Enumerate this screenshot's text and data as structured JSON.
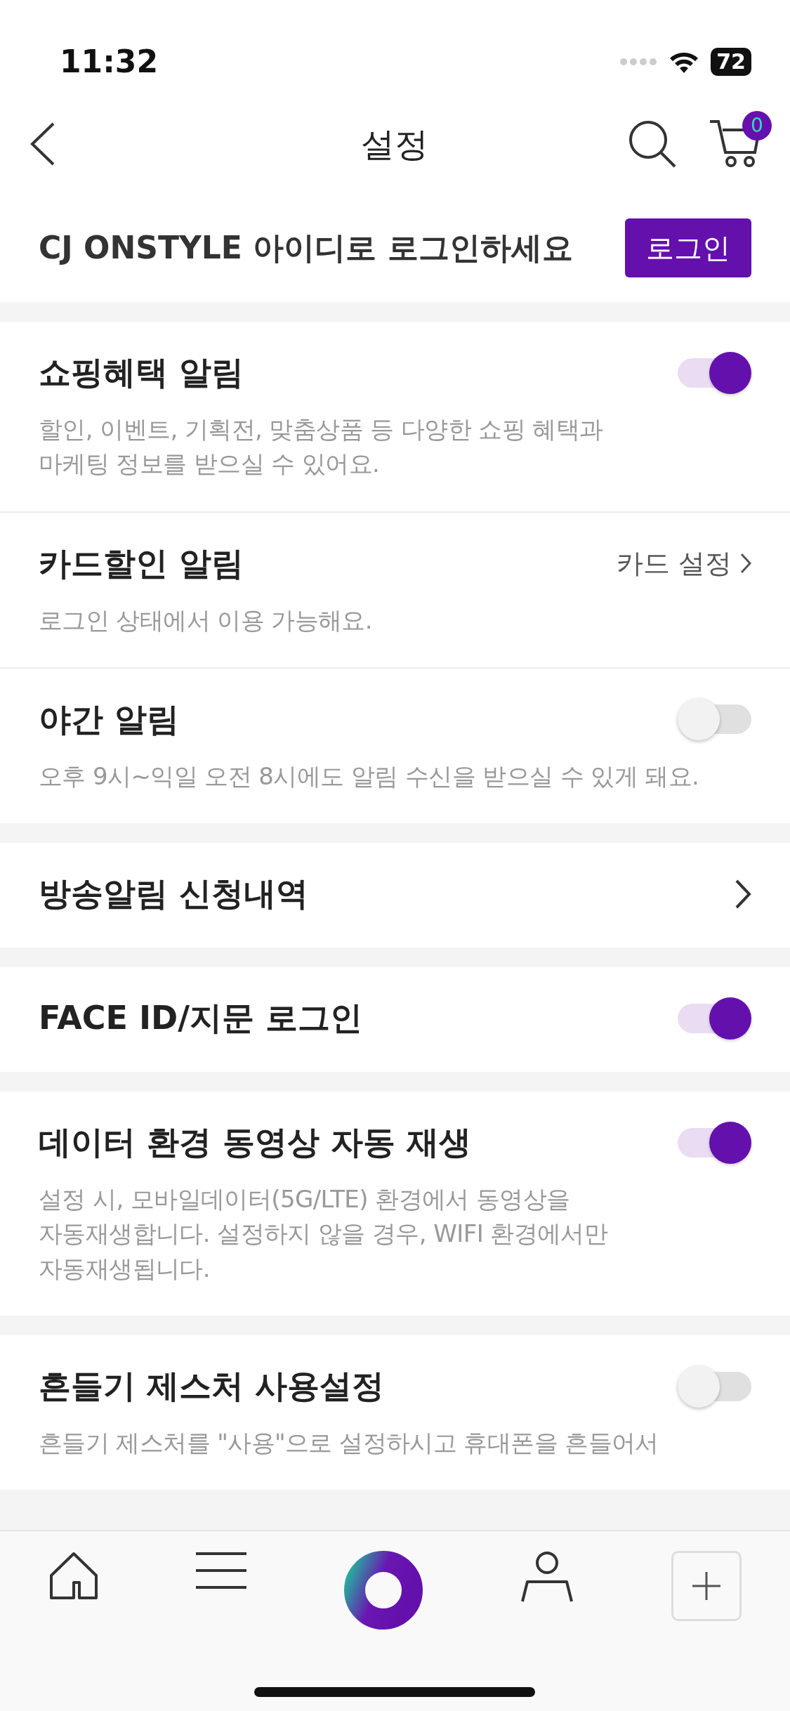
{
  "status_bar": {
    "time": "11:32",
    "battery": "72"
  },
  "header": {
    "title": "설정",
    "cart_count": "0"
  },
  "login": {
    "text": "CJ ONSTYLE 아이디로 로그인하세요",
    "button": "로그인"
  },
  "groups": [
    {
      "items": [
        {
          "kind": "toggle",
          "title": "쇼핑혜택 알림",
          "on": true,
          "description": "할인, 이벤트, 기획전, 맞춤상품 등 다양한 쇼핑 혜택과\n마케팅 정보를 받으실 수 있어요."
        },
        {
          "kind": "link",
          "title": "카드할인 알림",
          "link": "카드 설정",
          "description": "로그인 상태에서 이용 가능해요."
        },
        {
          "kind": "toggle",
          "title": "야간 알림",
          "on": false,
          "description": "오후 9시~익일 오전 8시에도 알림 수신을 받으실 수 있게 돼요."
        }
      ]
    },
    {
      "items": [
        {
          "kind": "arrow",
          "title": "방송알림 신청내역"
        }
      ]
    },
    {
      "items": [
        {
          "kind": "toggle",
          "title": "FACE ID/지문 로그인",
          "on": true
        }
      ]
    },
    {
      "items": [
        {
          "kind": "toggle",
          "title": "데이터 환경 동영상 자동 재생",
          "on": true,
          "description": "설정 시, 모바일데이터(5G/LTE) 환경에서 동영상을\n자동재생합니다. 설정하지 않을 경우, WIFI 환경에서만\n자동재생됩니다."
        }
      ]
    },
    {
      "items": [
        {
          "kind": "toggle",
          "title": "흔들기 제스처 사용설정",
          "on": false,
          "description": "흔들기 제스처를 \"사용\"으로 설정하시고 휴대폰을 흔들어서"
        }
      ]
    }
  ]
}
